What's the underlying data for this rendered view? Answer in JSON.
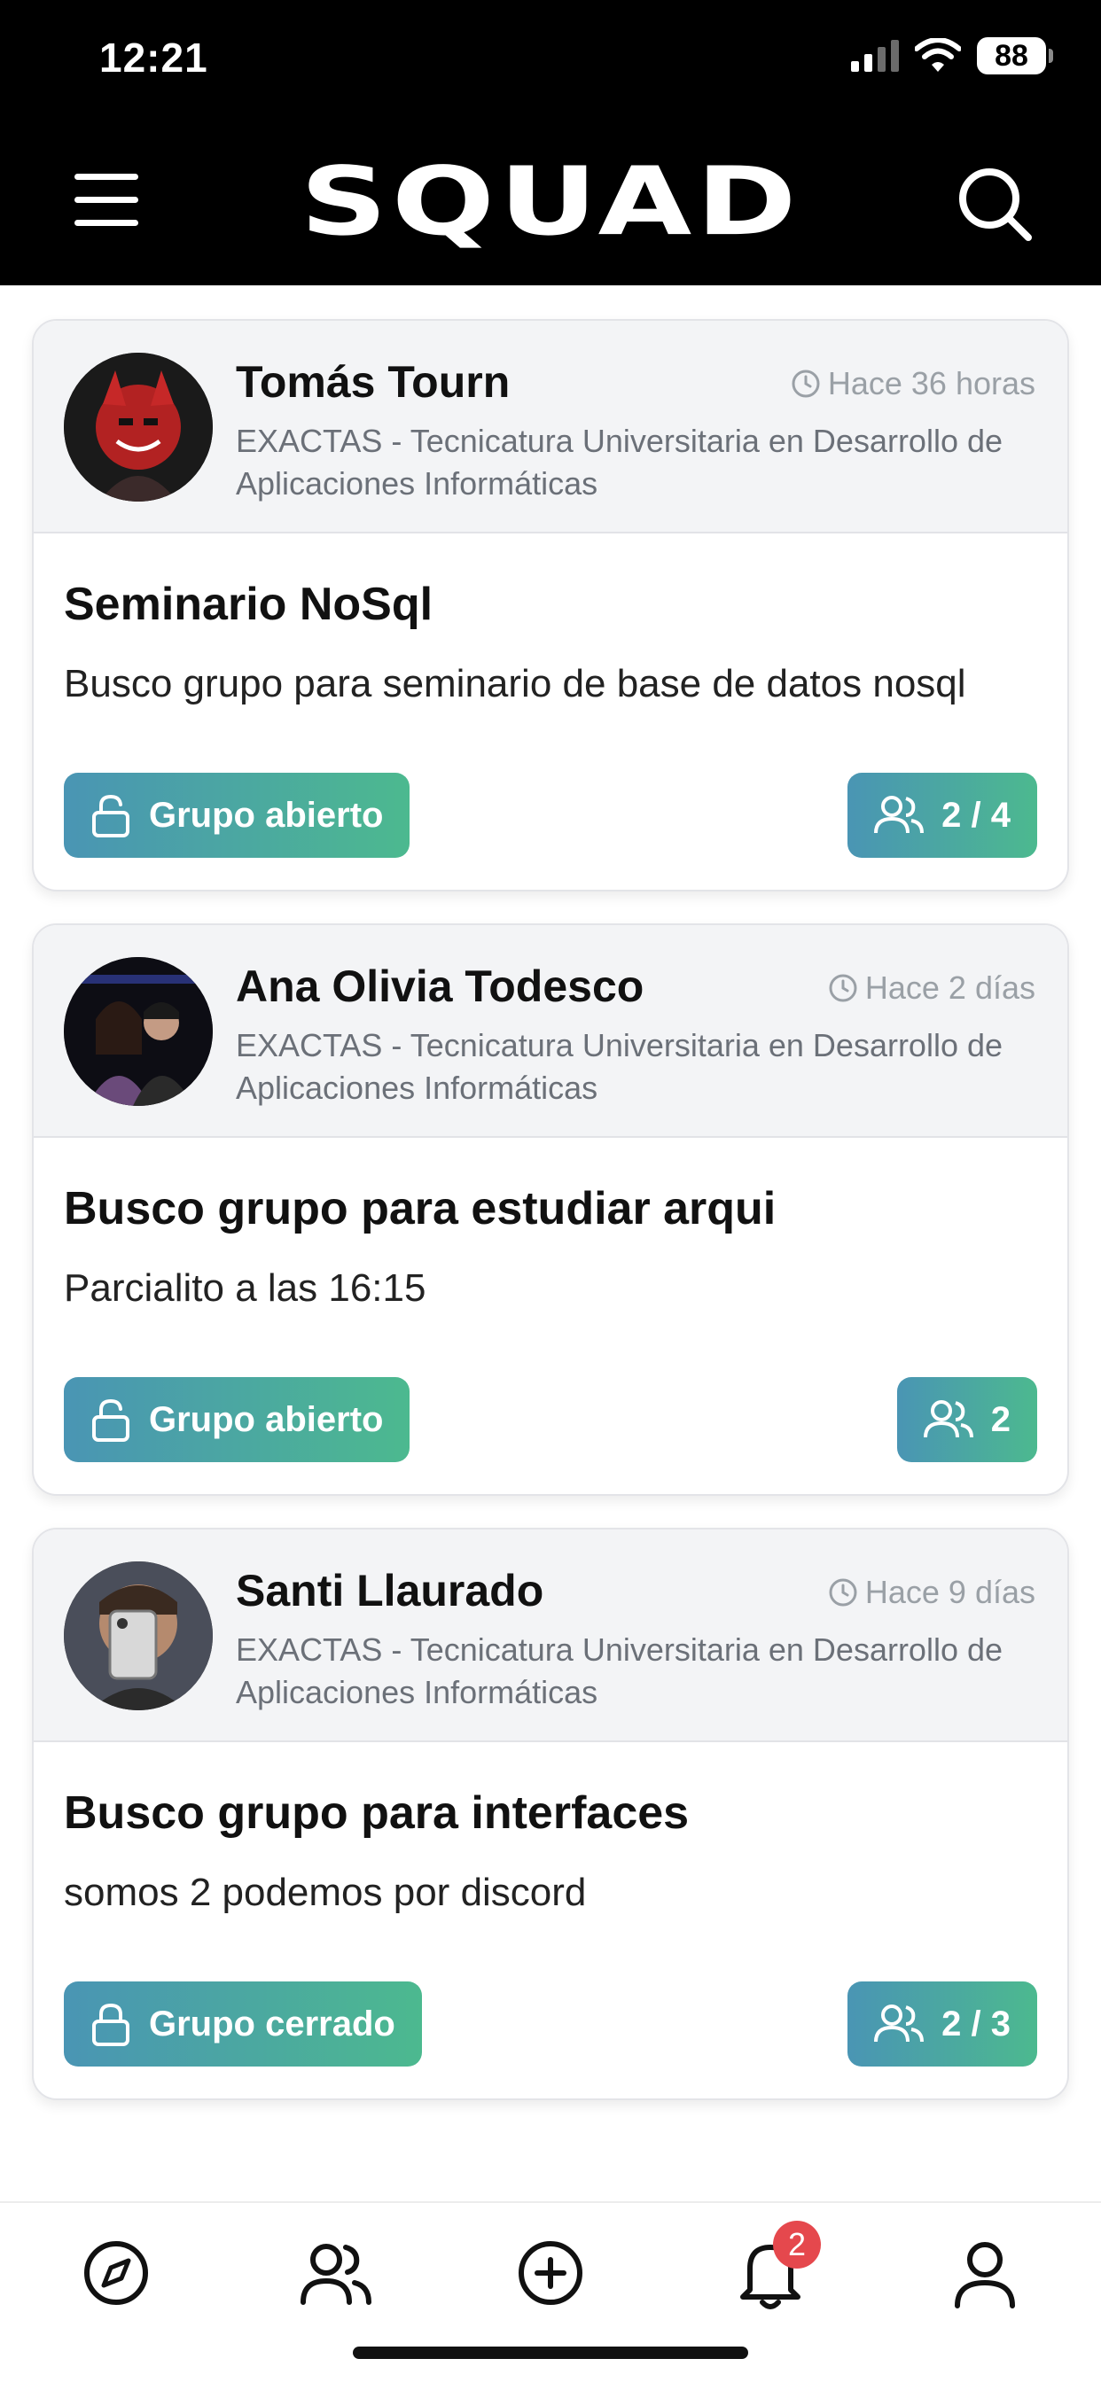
{
  "status_bar": {
    "time": "12:21",
    "battery": "88"
  },
  "header": {
    "logo": "SQUAD",
    "menu_icon": "hamburger-menu-icon",
    "search_icon": "search-icon"
  },
  "posts": [
    {
      "author": "Tomás Tourn",
      "time": "Hace 36 horas",
      "career": "EXACTAS - Tecnicatura Universitaria en Desarrollo de Aplicaciones Informáticas",
      "title": "Seminario NoSql",
      "description": "Busco grupo para seminario de base de datos nosql",
      "group_status": "Grupo abierto",
      "members": "2 / 4"
    },
    {
      "author": "Ana Olivia Todesco",
      "time": "Hace 2 días",
      "career": "EXACTAS - Tecnicatura Universitaria en Desarrollo de Aplicaciones Informáticas",
      "title": "Busco grupo para estudiar arqui",
      "description": "Parcialito a las 16:15",
      "group_status": "Grupo abierto",
      "members": "2"
    },
    {
      "author": "Santi Llaurado",
      "time": "Hace 9 días",
      "career": "EXACTAS - Tecnicatura Universitaria en Desarrollo de Aplicaciones Informáticas",
      "title": "Busco grupo para interfaces",
      "description": "somos 2 podemos por discord",
      "group_status": "Grupo cerrado",
      "members": "2 / 3"
    }
  ],
  "bottom_nav": {
    "items": [
      "compass-icon",
      "users-icon",
      "plus-circle-icon",
      "bell-icon",
      "user-icon"
    ],
    "notifications_badge": "2"
  },
  "colors": {
    "accent_start": "#4a95b4",
    "accent_end": "#4cb98f",
    "badge": "#e5484d"
  }
}
